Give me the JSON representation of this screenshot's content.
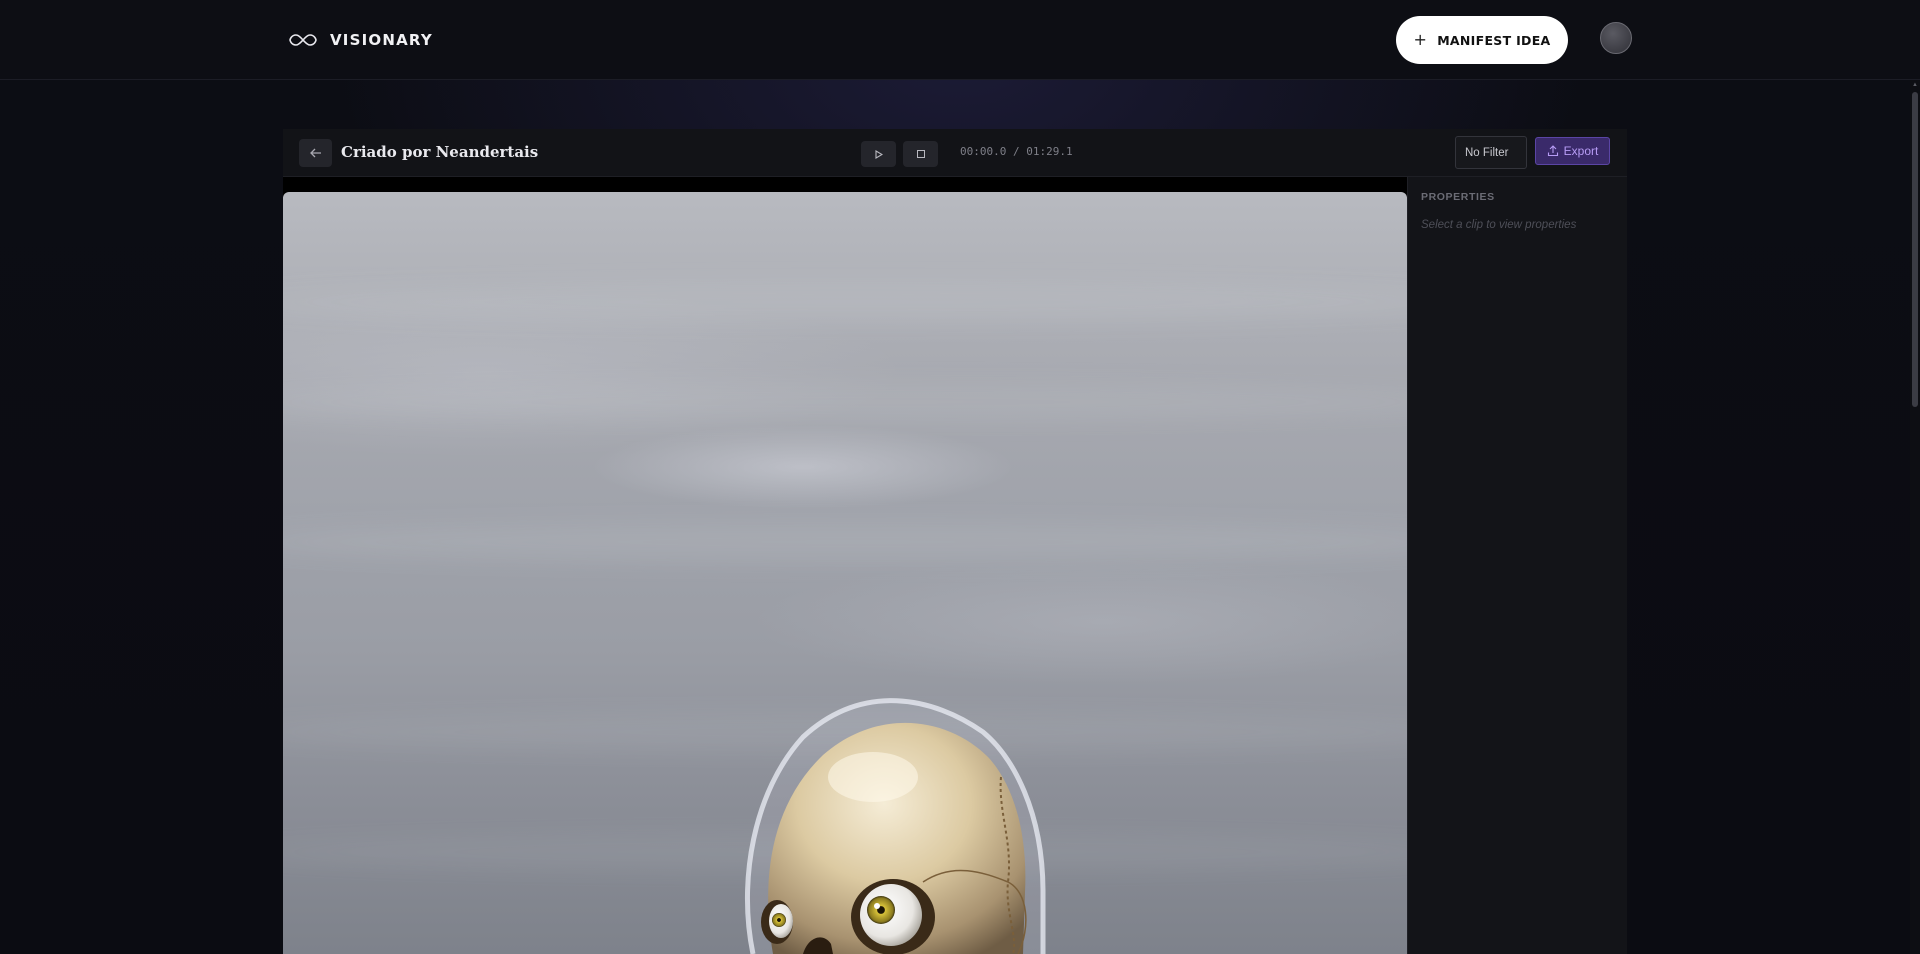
{
  "app": {
    "brand_name": "VISIONARY",
    "manifest_label": "MANIFEST IDEA"
  },
  "editor": {
    "project_title": "Criado por Neandertais",
    "timecode": "00:00.0 / 01:29.1",
    "filter_value": "No Filter",
    "export_label": "Export"
  },
  "properties": {
    "title": "PROPERTIES",
    "hint": "Select a clip to view properties"
  },
  "colors": {
    "accent": "#5b45a5",
    "accent_text": "#b79cf5"
  },
  "icons": {
    "brand": "infinity-icon",
    "manifest": "plus-icon",
    "back": "arrow-left-icon",
    "play": "play-icon",
    "stop": "stop-icon",
    "export": "upload-icon"
  }
}
